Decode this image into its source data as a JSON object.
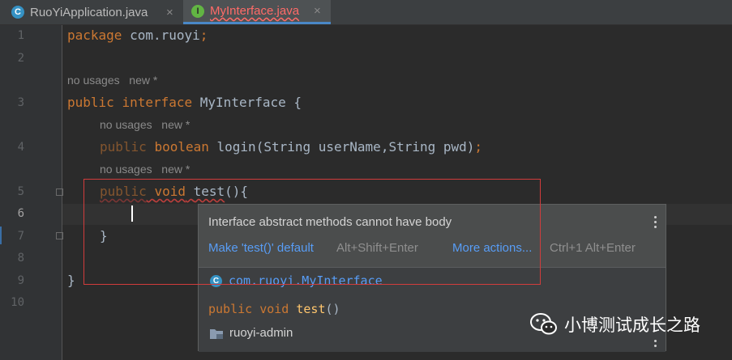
{
  "tabs": [
    {
      "label": "RuoYiApplication.java",
      "icon": "class-icon",
      "icon_letter": "C",
      "active": false
    },
    {
      "label": "MyInterface.java",
      "icon": "interface-icon",
      "icon_letter": "I",
      "active": true,
      "has_error": true
    }
  ],
  "close_glyph": "×",
  "line_numbers": [
    "1",
    "2",
    "3",
    "4",
    "5",
    "6",
    "7",
    "8",
    "9",
    "10"
  ],
  "code": {
    "line1": {
      "kw": "package",
      "rest": " com.ruoyi",
      "semi": ";"
    },
    "hint1": {
      "usages": "no usages",
      "new": "new *"
    },
    "line3": {
      "kw1": "public",
      "kw2": "interface",
      "name": "MyInterface",
      "brace": "{"
    },
    "hint2": {
      "usages": "no usages",
      "new": "new *"
    },
    "line4": {
      "kw1": "public",
      "kw2": "boolean",
      "name": "login",
      "params": "(String userName,String pwd)",
      "semi": ";"
    },
    "hint3": {
      "usages": "no usages",
      "new": "new *"
    },
    "line5": {
      "kw1": "public",
      "kw2": "void",
      "name": "test",
      "rest": "(){"
    },
    "line7": {
      "brace": "}"
    },
    "line9": {
      "brace": "}"
    }
  },
  "popup": {
    "message": "Interface abstract methods cannot have body",
    "fix_label": "Make 'test()' default",
    "fix_shortcut": "Alt+Shift+Enter",
    "more_label": "More actions...",
    "more_shortcut": "Ctrl+1 Alt+Enter",
    "class_ref": "com.ruoyi.MyInterface",
    "sig_kw1": "public",
    "sig_kw2": "void",
    "sig_name": "test",
    "sig_rest": "()",
    "module": "ruoyi-admin"
  },
  "watermark": {
    "text": "小博测试成长之路",
    "icon": "wechat-icon"
  },
  "colors": {
    "background": "#2b2b2b",
    "keyword": "#cc7832",
    "method": "#ffc66d",
    "link": "#589df6",
    "error": "#d23c3c"
  }
}
